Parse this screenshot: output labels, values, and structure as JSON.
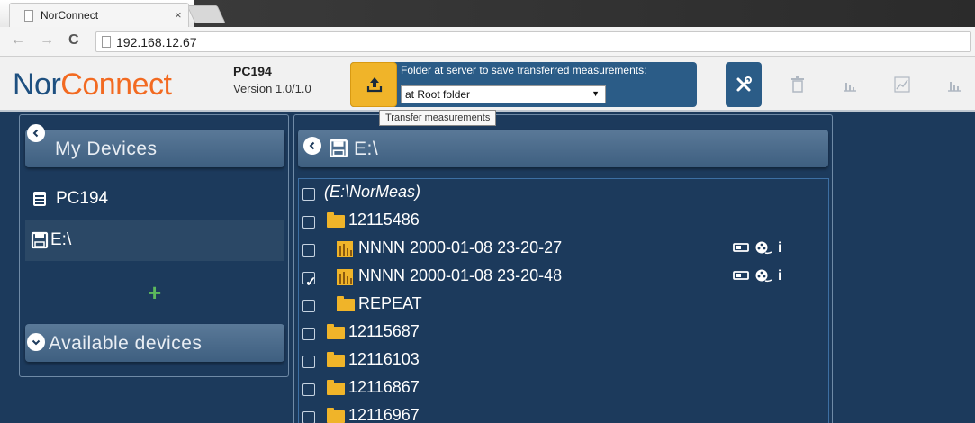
{
  "browser": {
    "tab_title": "NorConnect",
    "tab_close": "×",
    "url": "192.168.12.67",
    "back": "←",
    "forward": "→",
    "reload": "C"
  },
  "header": {
    "logo_part1": "Nor",
    "logo_part2": "Connect",
    "device_name": "PC194",
    "version": "Version 1.0/1.0",
    "transfer_label": "Folder at server to save transferred measurements:",
    "folder_selected": "at Root folder",
    "tooltip": "Transfer measurements"
  },
  "sidebar": {
    "my_devices_title": "My Devices",
    "devices": [
      {
        "label": "PC194",
        "icon": "server-icon"
      },
      {
        "label": "E:\\",
        "icon": "floppy-icon"
      }
    ],
    "add_label": "+",
    "available_title": "Available devices"
  },
  "main": {
    "title": "E:\\",
    "rows": [
      {
        "text": "(E:\\NorMeas)",
        "type": "root",
        "checked": false
      },
      {
        "text": "12115486",
        "type": "folder",
        "checked": false
      },
      {
        "text": "NNNN 2000-01-08 23-20-27",
        "type": "measurement",
        "checked": false
      },
      {
        "text": "NNNN 2000-01-08 23-20-48",
        "type": "measurement",
        "checked": true
      },
      {
        "text": "REPEAT",
        "type": "folder",
        "checked": false
      },
      {
        "text": "12115687",
        "type": "folder",
        "checked": false
      },
      {
        "text": "12116103",
        "type": "folder",
        "checked": false
      },
      {
        "text": "12116867",
        "type": "folder",
        "checked": false
      },
      {
        "text": "12116967",
        "type": "folder",
        "checked": false
      }
    ],
    "info_label": "i",
    "checkmark": "✓"
  },
  "colors": {
    "background": "#1c3a5c",
    "accent_orange": "#f26a21",
    "logo_blue": "#1e5080",
    "transfer_yellow": "#f0b429",
    "add_green": "#5cb85c"
  }
}
